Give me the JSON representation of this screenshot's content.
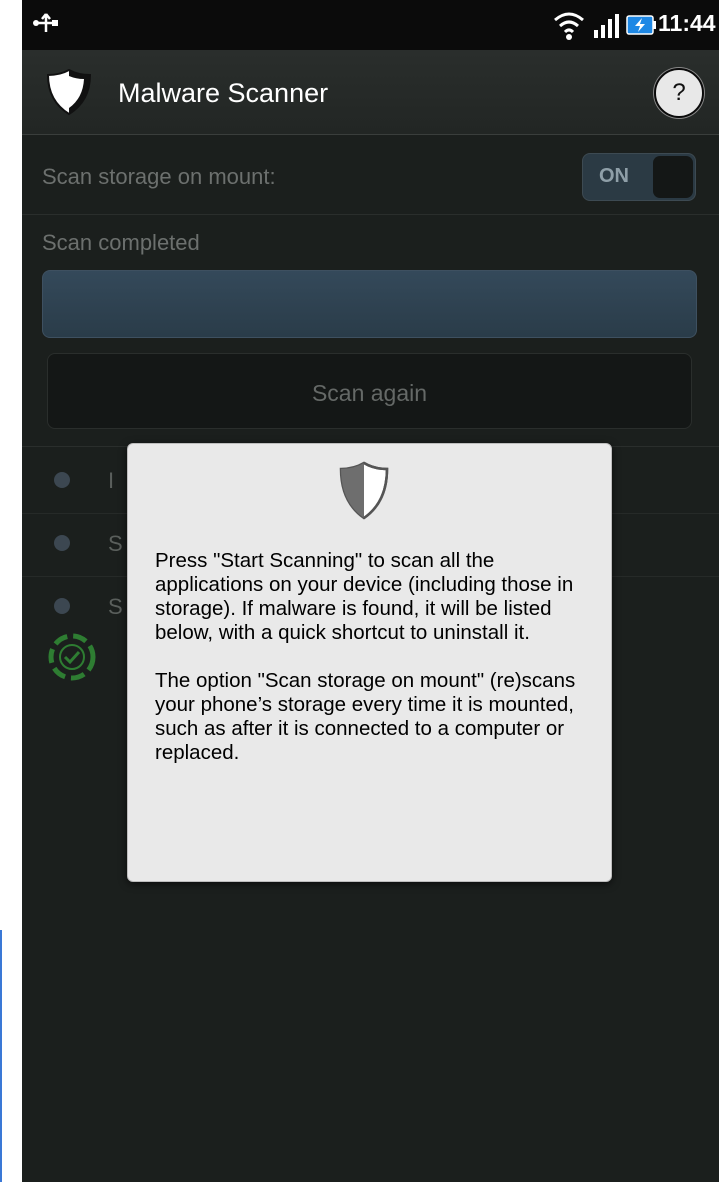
{
  "status_bar": {
    "time": "11:44"
  },
  "app_bar": {
    "title": "Malware Scanner",
    "help_label": "?"
  },
  "settings": {
    "scan_on_mount_label": "Scan storage on mount:",
    "scan_on_mount_toggle": "ON"
  },
  "scan": {
    "status_text": "Scan completed",
    "scan_again_label": "Scan again"
  },
  "list_rows": [
    {
      "label": "I"
    },
    {
      "label": "S"
    },
    {
      "label": "S"
    }
  ],
  "dialog": {
    "text": "Press \"Start Scanning\" to scan all the applications on your device (including those in storage). If malware is found, it will be listed below, with a quick shortcut to uninstall it.\n\nThe option \"Scan storage on mount\" (re)scans your phone’s storage every time it is mounted, such as after it is connected to a computer or replaced."
  },
  "colors": {
    "background": "#1b1f1d",
    "dialog_bg": "#e9e9e9",
    "accent_green": "#2e7d32",
    "toggle_bg": "#2b3a44"
  }
}
